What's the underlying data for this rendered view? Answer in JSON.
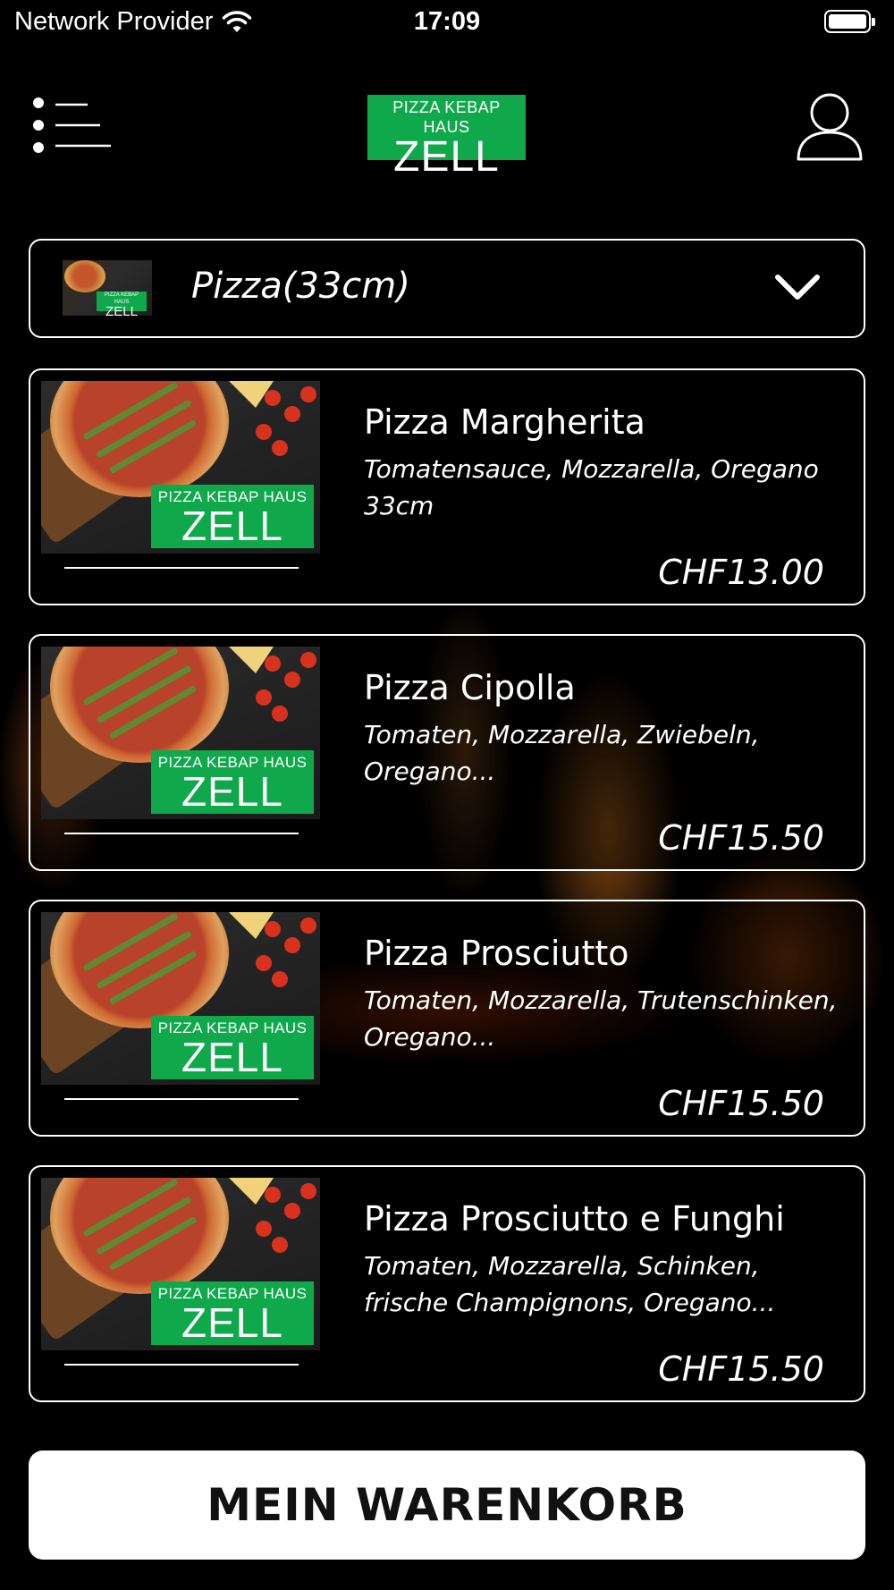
{
  "status_bar": {
    "carrier": "Network Provider",
    "time": "17:09",
    "wifi_icon": "wifi-icon",
    "battery_icon": "battery-icon"
  },
  "header": {
    "menu_icon": "menu-list-icon",
    "logo_top": "PIZZA KEBAP HAUS",
    "logo_main": "ZELL",
    "user_icon": "user-icon"
  },
  "category": {
    "selected": "Pizza(33cm)",
    "thumb_logo_top": "PIZZA KEBAP HAUS",
    "thumb_logo_main": "ZELL"
  },
  "products": [
    {
      "name": "Pizza Margherita",
      "description": "Tomatensauce, Mozzarella, Oregano 33cm",
      "price": "CHF13.00",
      "logo_top": "PIZZA KEBAP HAUS",
      "logo_main": "ZELL"
    },
    {
      "name": "Pizza Cipolla",
      "description": "Tomaten, Mozzarella, Zwiebeln, Oregano...",
      "price": "CHF15.50",
      "logo_top": "PIZZA KEBAP HAUS",
      "logo_main": "ZELL"
    },
    {
      "name": "Pizza Prosciutto",
      "description": "Tomaten, Mozzarella, Trutenschinken, Oregano...",
      "price": "CHF15.50",
      "logo_top": "PIZZA KEBAP HAUS",
      "logo_main": "ZELL"
    },
    {
      "name": "Pizza Prosciutto e Funghi",
      "description": "Tomaten, Mozzarella, Schinken, frische Champignons, Oregano...",
      "price": "CHF15.50",
      "logo_top": "PIZZA KEBAP HAUS",
      "logo_main": "ZELL"
    }
  ],
  "cart_button": {
    "label": "MEIN WARENKORB"
  },
  "colors": {
    "brand_green": "#0fa84b",
    "background": "#000000",
    "text": "#ffffff"
  }
}
